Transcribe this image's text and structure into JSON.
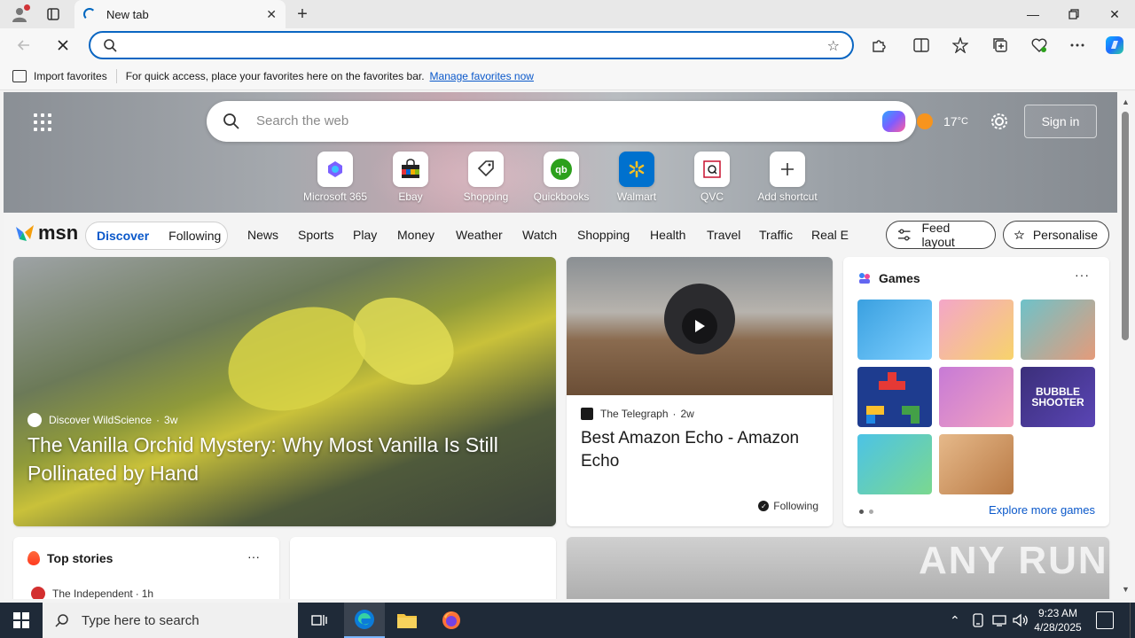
{
  "browser": {
    "tab_title": "New tab",
    "address_value": "",
    "favorites_bar": {
      "import_label": "Import favorites",
      "message": "For quick access, place your favorites here on the favorites bar.",
      "manage_link": "Manage favorites now"
    }
  },
  "msn": {
    "search_placeholder": "Search the web",
    "weather_temp": "17",
    "weather_unit": "°C",
    "sign_in": "Sign in",
    "shortcuts": [
      {
        "label": "Microsoft 365",
        "color": "#7b61ff"
      },
      {
        "label": "Ebay",
        "color": "#e53238"
      },
      {
        "label": "Shopping",
        "color": "#333333"
      },
      {
        "label": "Quickbooks",
        "color": "#2ca01c"
      },
      {
        "label": "Walmart",
        "color": "#0071ce"
      },
      {
        "label": "QVC",
        "color": "#c8102e"
      },
      {
        "label": "Add shortcut",
        "color": "#333333"
      }
    ],
    "logo_text": "msn",
    "segments": {
      "discover": "Discover",
      "following": "Following"
    },
    "nav": [
      "News",
      "Sports",
      "Play",
      "Money",
      "Weather",
      "Watch",
      "Shopping",
      "Health",
      "Travel",
      "Traffic",
      "Real E"
    ],
    "feed_layout": "Feed layout",
    "personalise": "Personalise",
    "main_story": {
      "source": "Discover WildScience",
      "age": "3w",
      "headline": "The Vanilla Orchid Mystery: Why Most Vanilla Is Still Pollinated by Hand"
    },
    "echo_story": {
      "source": "The Telegraph",
      "age": "2w",
      "headline": "Best Amazon Echo - Amazon Echo",
      "following": "Following"
    },
    "games": {
      "title": "Games",
      "more": "···",
      "explore": "Explore more games",
      "tiles": [
        {
          "name": "game-tile-restaurant",
          "color": "#3aa0e0"
        },
        {
          "name": "game-tile-makeover",
          "color": "#f4a6c8"
        },
        {
          "name": "game-tile-hospital",
          "color": "#6ec2c9"
        },
        {
          "name": "game-tile-blocks",
          "color": "#1e3c8f"
        },
        {
          "name": "game-tile-makeup",
          "color": "#c77ad6"
        },
        {
          "name": "game-tile-bubble-shooter",
          "color": "#3b2f7a",
          "text": "BUBBLE SHOOTER"
        },
        {
          "name": "game-tile-foot",
          "color": "#4cc3e6"
        },
        {
          "name": "game-tile-screws",
          "color": "#e6b98a"
        }
      ]
    },
    "top_stories": {
      "title": "Top stories",
      "more": "···",
      "source": "The Independent",
      "age": "1h"
    }
  },
  "taskbar": {
    "search_placeholder": "Type here to search",
    "time": "9:23 AM",
    "date": "4/28/2025"
  },
  "watermark": "ANY RUN"
}
